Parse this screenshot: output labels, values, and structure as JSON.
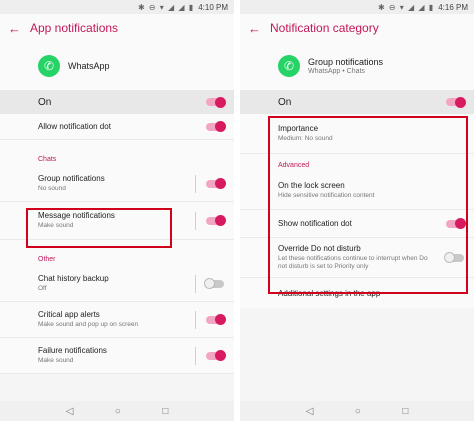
{
  "status": {
    "icons": "✱ ⊖ ▾ ◢ ◢ ▮",
    "left_time": "4:10 PM",
    "right_time": "4:16 PM"
  },
  "left": {
    "title": "App notifications",
    "app_name": "WhatsApp",
    "on_label": "On",
    "allow_dot": "Allow notification dot",
    "section_chats": "Chats",
    "group": {
      "title": "Group notifications",
      "sub": "No sound"
    },
    "message": {
      "title": "Message notifications",
      "sub": "Make sound"
    },
    "section_other": "Other",
    "backup": {
      "title": "Chat history backup",
      "sub": "Off"
    },
    "critical": {
      "title": "Critical app alerts",
      "sub": "Make sound and pop up on screen"
    },
    "failure": {
      "title": "Failure notifications",
      "sub": "Make sound"
    }
  },
  "right": {
    "title": "Notification category",
    "cat_name": "Group notifications",
    "cat_sub": "WhatsApp • Chats",
    "on_label": "On",
    "importance": {
      "title": "Importance",
      "sub": "Medium: No sound"
    },
    "section_advanced": "Advanced",
    "lock": {
      "title": "On the lock screen",
      "sub": "Hide sensitive notification content"
    },
    "show_dot": "Show notification dot",
    "override": {
      "title": "Override Do not disturb",
      "sub": "Let these notifications continue to interrupt when Do not disturb is set to Priority only"
    },
    "additional": "Additional settings in the app"
  },
  "nav": {
    "back": "◁",
    "home": "○",
    "recents": "□"
  },
  "icons": {
    "back": "arrow-left-icon",
    "whatsapp": "whatsapp-logo-icon"
  },
  "colors": {
    "accent": "#c2185b",
    "highlight": "#d0021b",
    "whatsapp": "#25d366"
  }
}
